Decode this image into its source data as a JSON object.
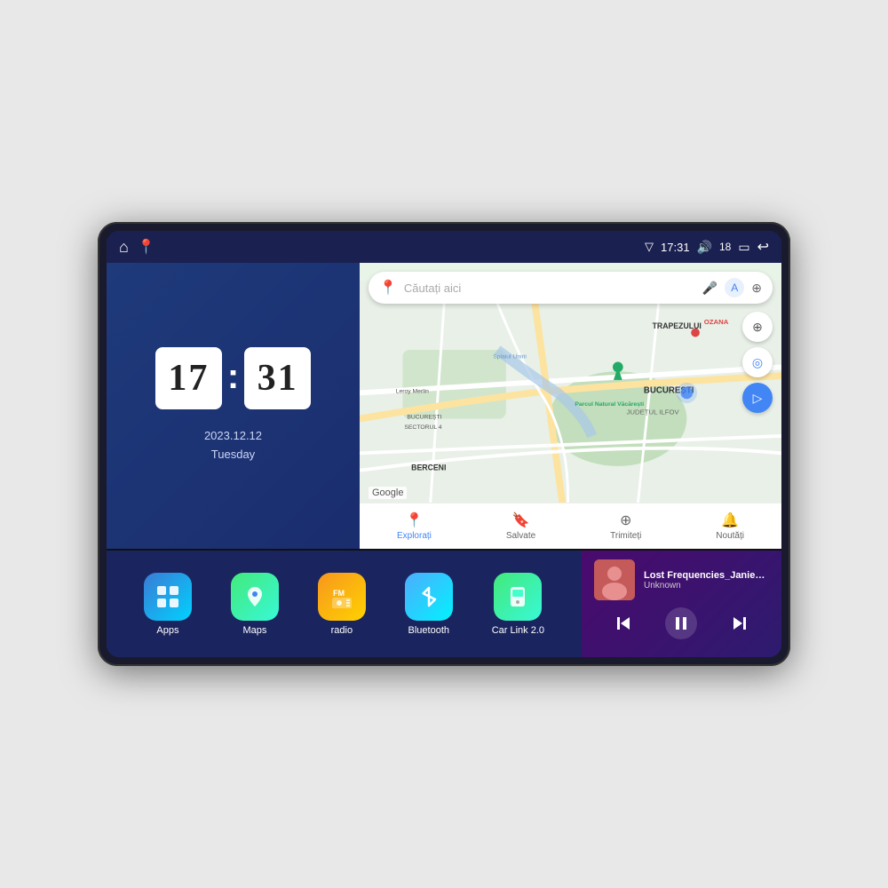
{
  "device": {
    "screen": {
      "status_bar": {
        "left_icons": [
          "home-icon",
          "maps-icon"
        ],
        "signal_icon": "▽",
        "time": "17:31",
        "volume_icon": "🔊",
        "battery_level": "18",
        "battery_icon": "🔋",
        "back_icon": "↩"
      },
      "clock": {
        "hours": "17",
        "minutes": "31",
        "date": "2023.12.12",
        "day": "Tuesday"
      },
      "map": {
        "search_placeholder": "Căutați aici",
        "nav_items": [
          {
            "label": "Explorați",
            "active": true
          },
          {
            "label": "Salvate",
            "active": false
          },
          {
            "label": "Trimiteți",
            "active": false
          },
          {
            "label": "Noutăți",
            "active": false
          }
        ],
        "map_labels": [
          "TRAPEZULUI",
          "BUCUREȘTI",
          "JUDEȚUL ILFOV",
          "BERCENI",
          "Parcul Natural Văcărești",
          "Leroy Merlin",
          "BUCUREȘTI SECTORUL 4",
          "Splaiul Unirii",
          "OZANA"
        ]
      },
      "apps": [
        {
          "id": "apps",
          "label": "Apps",
          "icon_class": "app-icon-apps",
          "icon": "⊞"
        },
        {
          "id": "maps",
          "label": "Maps",
          "icon_class": "app-icon-maps",
          "icon": "📍"
        },
        {
          "id": "radio",
          "label": "radio",
          "icon_class": "app-icon-radio",
          "icon": "📻"
        },
        {
          "id": "bluetooth",
          "label": "Bluetooth",
          "icon_class": "app-icon-bluetooth",
          "icon": "⬡"
        },
        {
          "id": "carlink",
          "label": "Car Link 2.0",
          "icon_class": "app-icon-carlink",
          "icon": "📱"
        }
      ],
      "music": {
        "title": "Lost Frequencies_Janieck Devy-...",
        "artist": "Unknown",
        "controls": {
          "prev": "⏮",
          "play": "⏸",
          "next": "⏭"
        }
      }
    }
  }
}
